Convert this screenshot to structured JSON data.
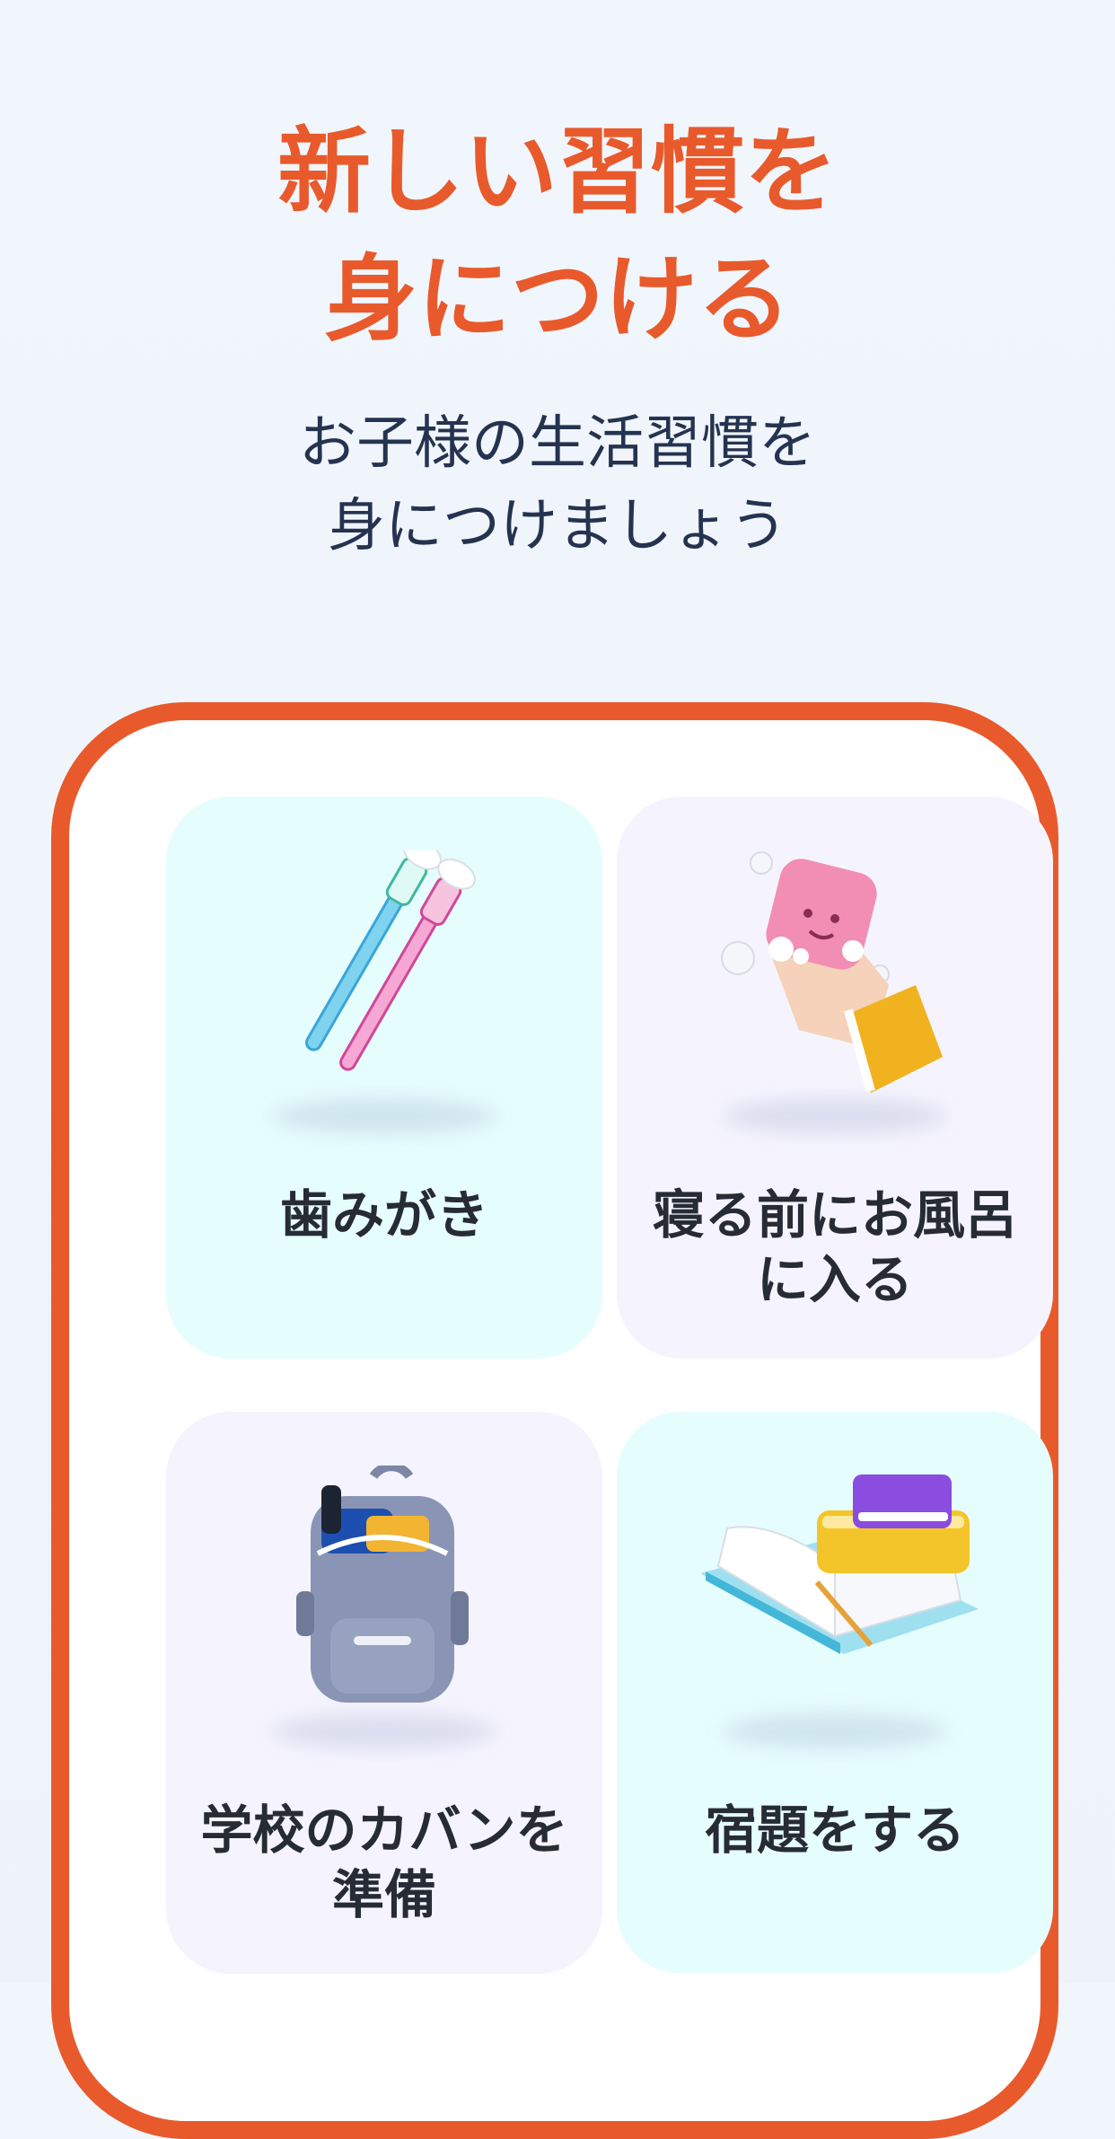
{
  "header": {
    "title_lines": [
      "新しい習慣を",
      "身につける"
    ],
    "subtitle_lines": [
      "お子様の生活習慣を",
      "身につけましょう"
    ]
  },
  "habits": [
    {
      "label_lines": [
        "歯みがき"
      ],
      "icon": "toothbrush-icon",
      "bg": "#e6fdfe"
    },
    {
      "label_lines": [
        "寝る前にお風呂",
        "に入る"
      ],
      "icon": "soap-hand-icon",
      "bg": "#f5f4fe"
    },
    {
      "label_lines": [
        "学校のカバンを",
        "準備"
      ],
      "icon": "backpack-icon",
      "bg": "#f5f4fe"
    },
    {
      "label_lines": [
        "宿題をする"
      ],
      "icon": "books-icon",
      "bg": "#e6fdfe"
    }
  ],
  "colors": {
    "accent": "#e85a2c",
    "subtitle": "#253350",
    "label": "#262b35"
  }
}
